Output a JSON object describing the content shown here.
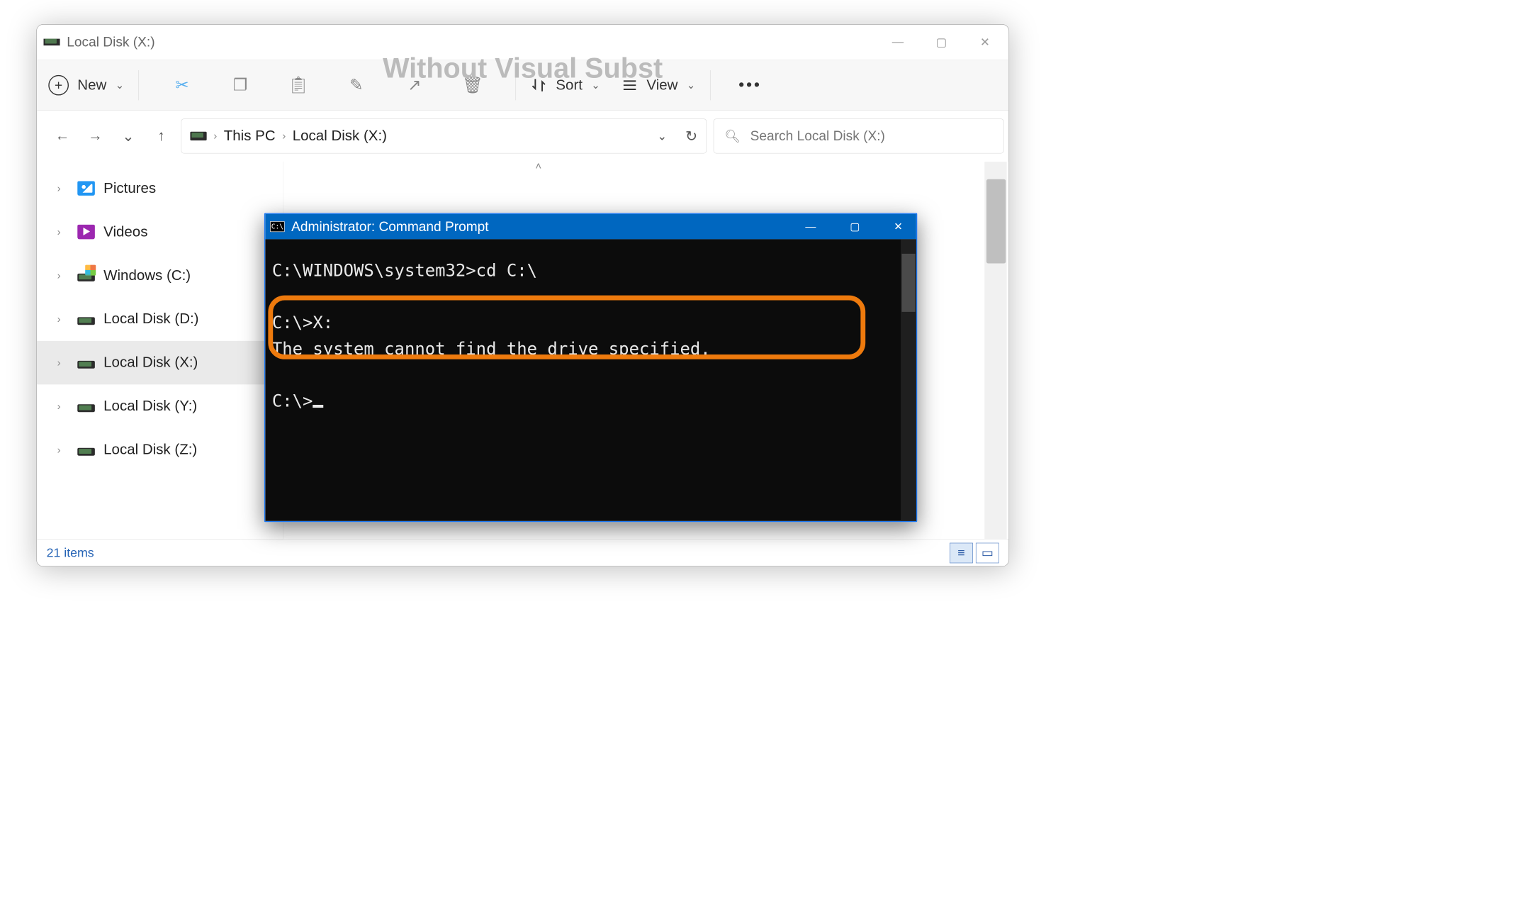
{
  "overlay_label": "Without Visual Subst",
  "explorer": {
    "title": "Local Disk (X:)",
    "window_buttons": {
      "minimize": "—",
      "maximize": "▢",
      "close": "✕"
    },
    "toolbar": {
      "new_label": "New",
      "sort_label": "Sort",
      "view_label": "View"
    },
    "breadcrumb": {
      "pc": "This PC",
      "loc": "Local Disk (X:)"
    },
    "search_placeholder": "Search Local Disk (X:)",
    "sidebar": [
      {
        "label": "Pictures",
        "icon": "pictures"
      },
      {
        "label": "Videos",
        "icon": "videos"
      },
      {
        "label": "Windows (C:)",
        "icon": "drive-win"
      },
      {
        "label": "Local Disk (D:)",
        "icon": "drive"
      },
      {
        "label": "Local Disk (X:)",
        "icon": "drive",
        "selected": true
      },
      {
        "label": "Local Disk (Y:)",
        "icon": "drive"
      },
      {
        "label": "Local Disk (Z:)",
        "icon": "drive"
      }
    ],
    "status_text": "21 items"
  },
  "cmd": {
    "title": "Administrator: Command Prompt",
    "lines": {
      "l1": "C:\\WINDOWS\\system32>cd C:\\",
      "l2": "C:\\>X:",
      "l3": "The system cannot find the drive specified.",
      "l4": "C:\\>"
    }
  }
}
